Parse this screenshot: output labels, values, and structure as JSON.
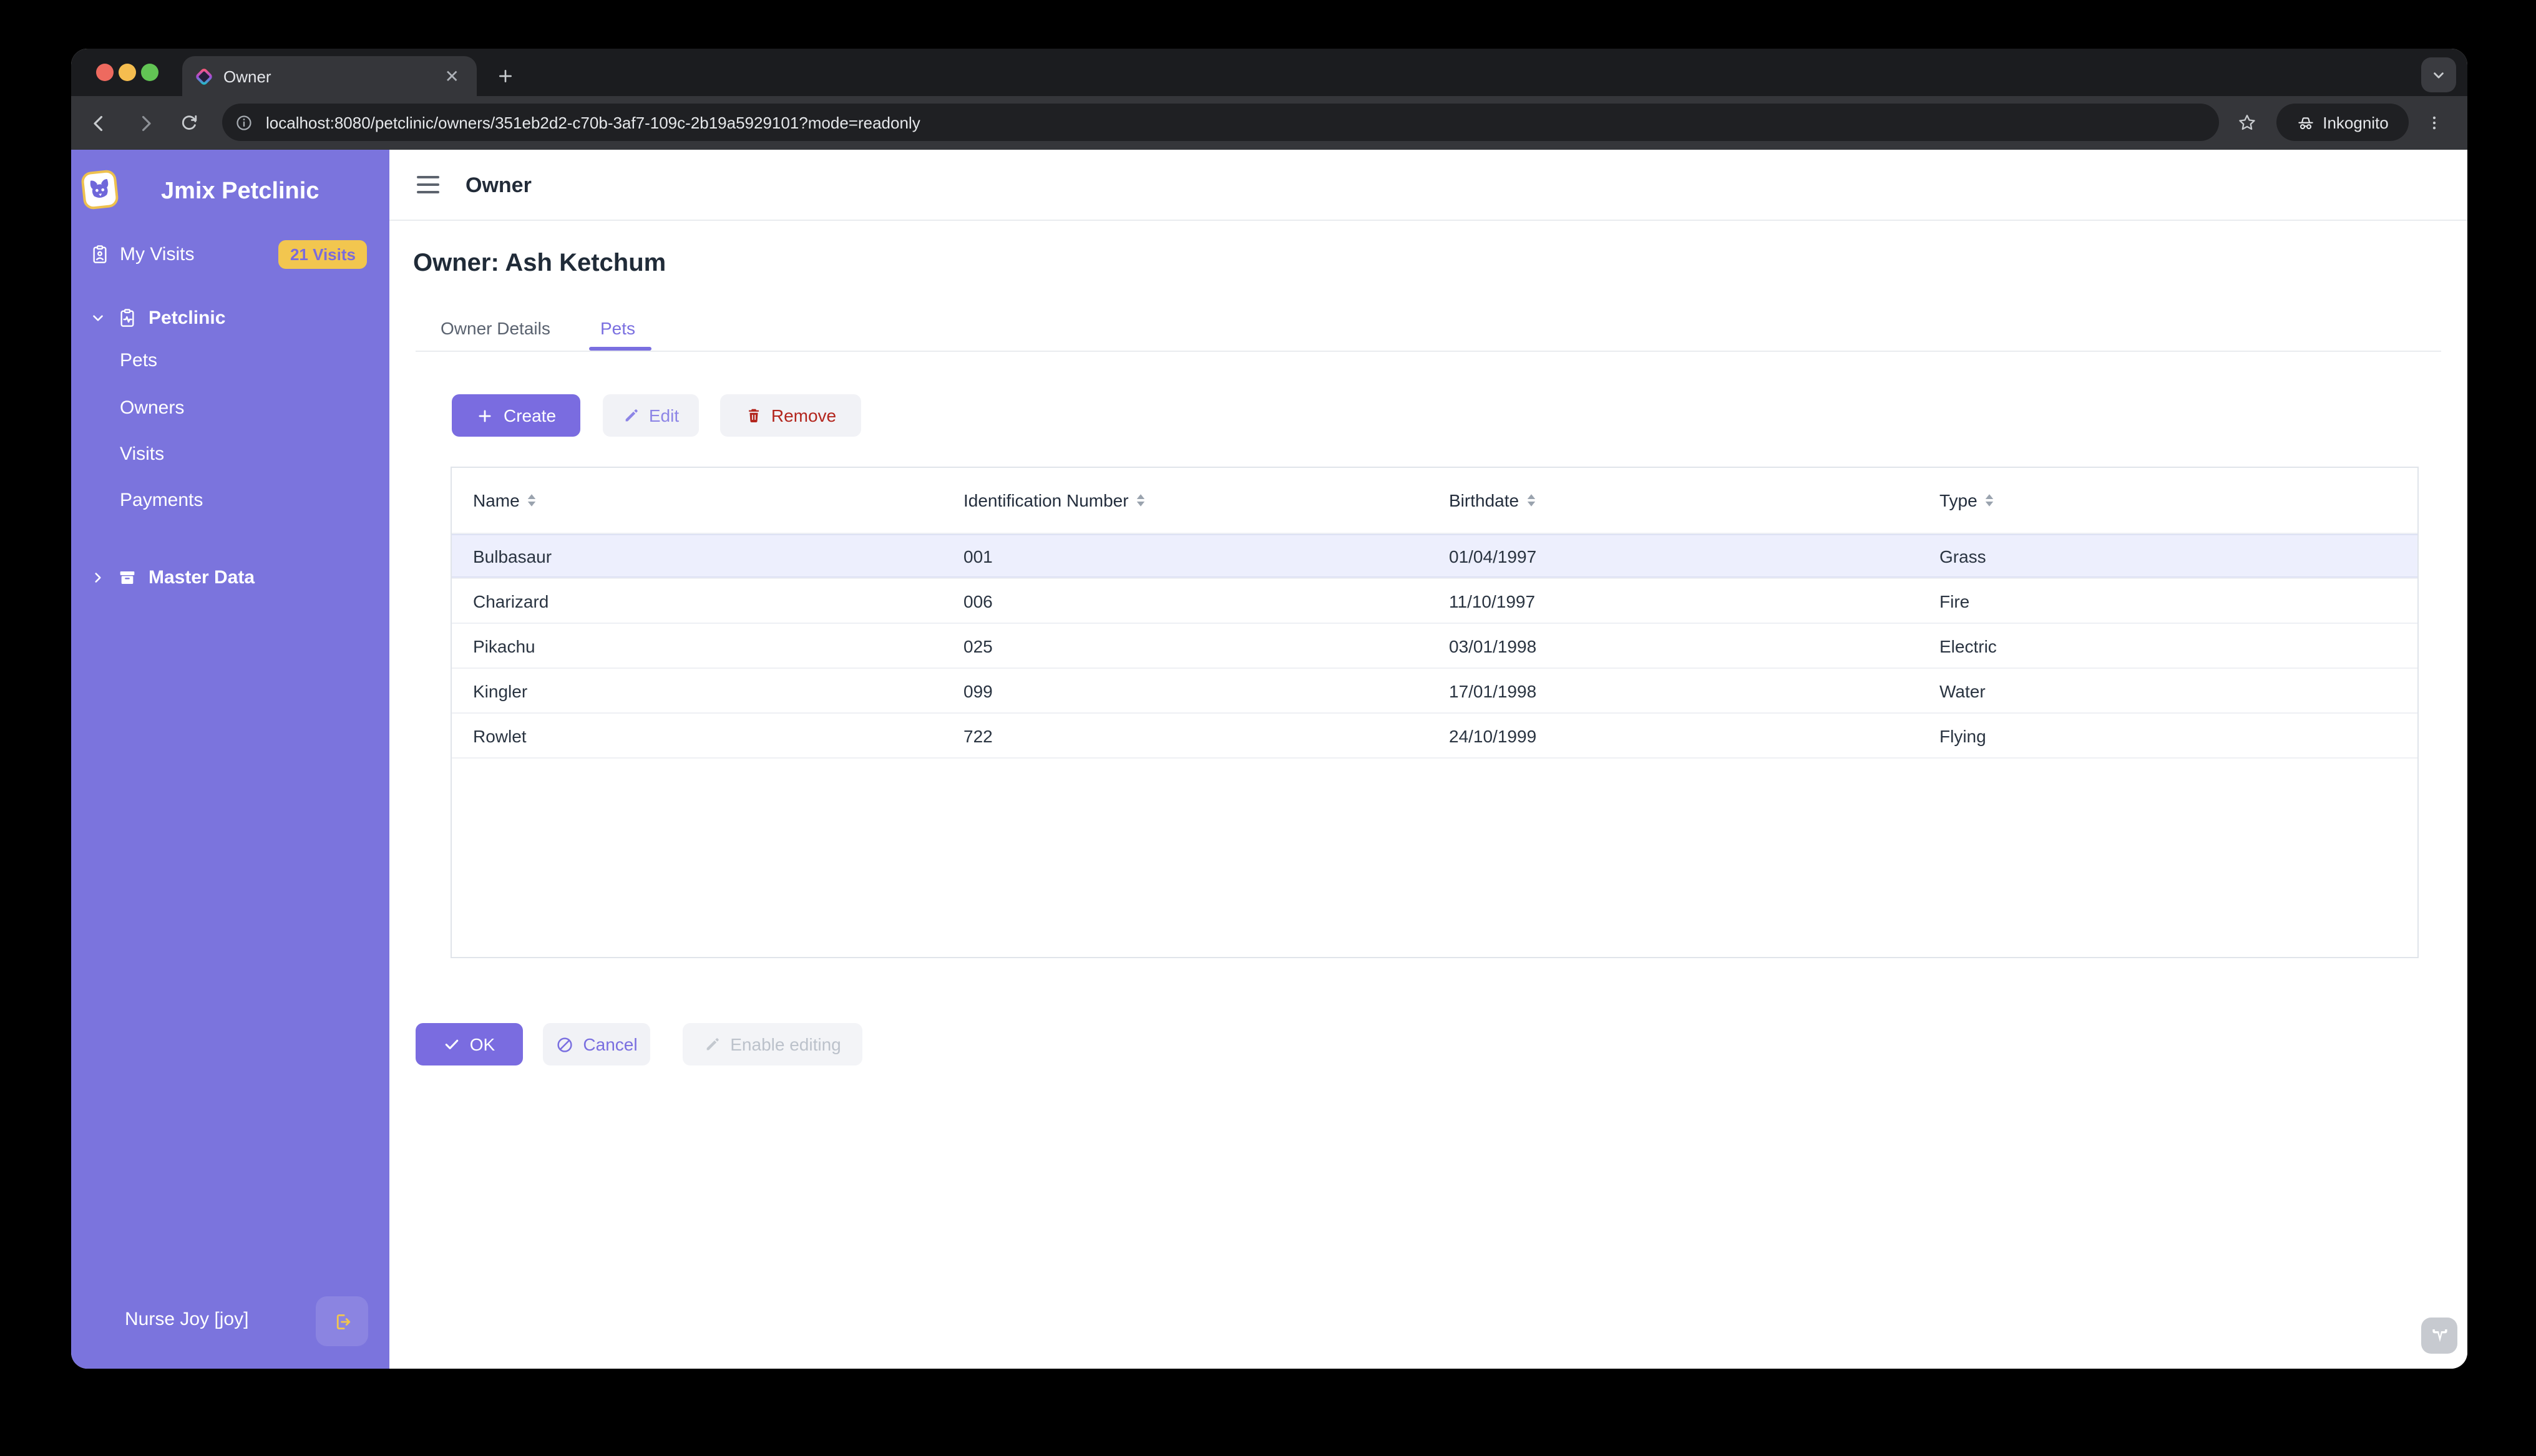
{
  "browser": {
    "tab_title": "Owner",
    "url": "localhost:8080/petclinic/owners/351eb2d2-c70b-3af7-109c-2b19a5929101?mode=readonly",
    "incognito_label": "Inkognito"
  },
  "sidebar": {
    "app_title": "Jmix Petclinic",
    "my_visits_label": "My Visits",
    "my_visits_badge": "21 Visits",
    "petclinic_label": "Petclinic",
    "items": [
      "Pets",
      "Owners",
      "Visits",
      "Payments"
    ],
    "master_data_label": "Master Data",
    "user_label": "Nurse Joy [joy]"
  },
  "main": {
    "app_bar_title": "Owner",
    "page_title": "Owner: Ash Ketchum",
    "tabs": [
      {
        "label": "Owner Details",
        "active": false
      },
      {
        "label": "Pets",
        "active": true
      }
    ],
    "actions": {
      "create": "Create",
      "edit": "Edit",
      "remove": "Remove"
    },
    "table": {
      "columns": [
        "Name",
        "Identification Number",
        "Birthdate",
        "Type"
      ],
      "rows": [
        {
          "name": "Bulbasaur",
          "id": "001",
          "birthdate": "01/04/1997",
          "type": "Grass"
        },
        {
          "name": "Charizard",
          "id": "006",
          "birthdate": "11/10/1997",
          "type": "Fire"
        },
        {
          "name": "Pikachu",
          "id": "025",
          "birthdate": "03/01/1998",
          "type": "Electric"
        },
        {
          "name": "Kingler",
          "id": "099",
          "birthdate": "17/01/1998",
          "type": "Water"
        },
        {
          "name": "Rowlet",
          "id": "722",
          "birthdate": "24/10/1999",
          "type": "Flying"
        }
      ]
    },
    "footer": {
      "ok": "OK",
      "cancel": "Cancel",
      "enable_editing": "Enable editing"
    }
  },
  "colors": {
    "sidebar_purple": "#7b74dd",
    "primary_purple": "#7a6ce0",
    "badge_yellow": "#f2c64f",
    "remove_red": "#b3261e",
    "selected_row": "#edeffd"
  }
}
